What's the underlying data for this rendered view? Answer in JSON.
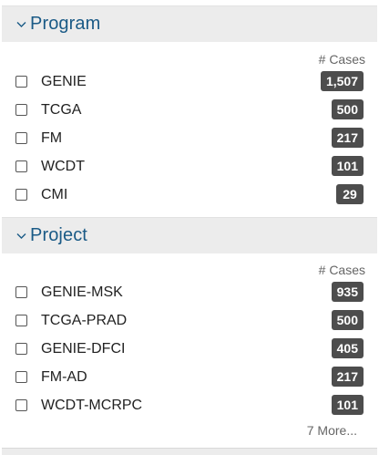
{
  "facets": {
    "program": {
      "title": "Program",
      "cases_header": "# Cases",
      "items": [
        {
          "label": "GENIE",
          "count": "1,507"
        },
        {
          "label": "TCGA",
          "count": "500"
        },
        {
          "label": "FM",
          "count": "217"
        },
        {
          "label": "WCDT",
          "count": "101"
        },
        {
          "label": "CMI",
          "count": "29"
        }
      ]
    },
    "project": {
      "title": "Project",
      "cases_header": "# Cases",
      "items": [
        {
          "label": "GENIE-MSK",
          "count": "935"
        },
        {
          "label": "TCGA-PRAD",
          "count": "500"
        },
        {
          "label": "GENIE-DFCI",
          "count": "405"
        },
        {
          "label": "FM-AD",
          "count": "217"
        },
        {
          "label": "WCDT-MCRPC",
          "count": "101"
        }
      ],
      "more_label": "7 More..."
    }
  },
  "icons": {
    "chevron": "chevron-down-icon"
  },
  "colors": {
    "title": "#1a5a86",
    "header_bg": "#ececec",
    "badge_bg": "#4d4d4d"
  }
}
